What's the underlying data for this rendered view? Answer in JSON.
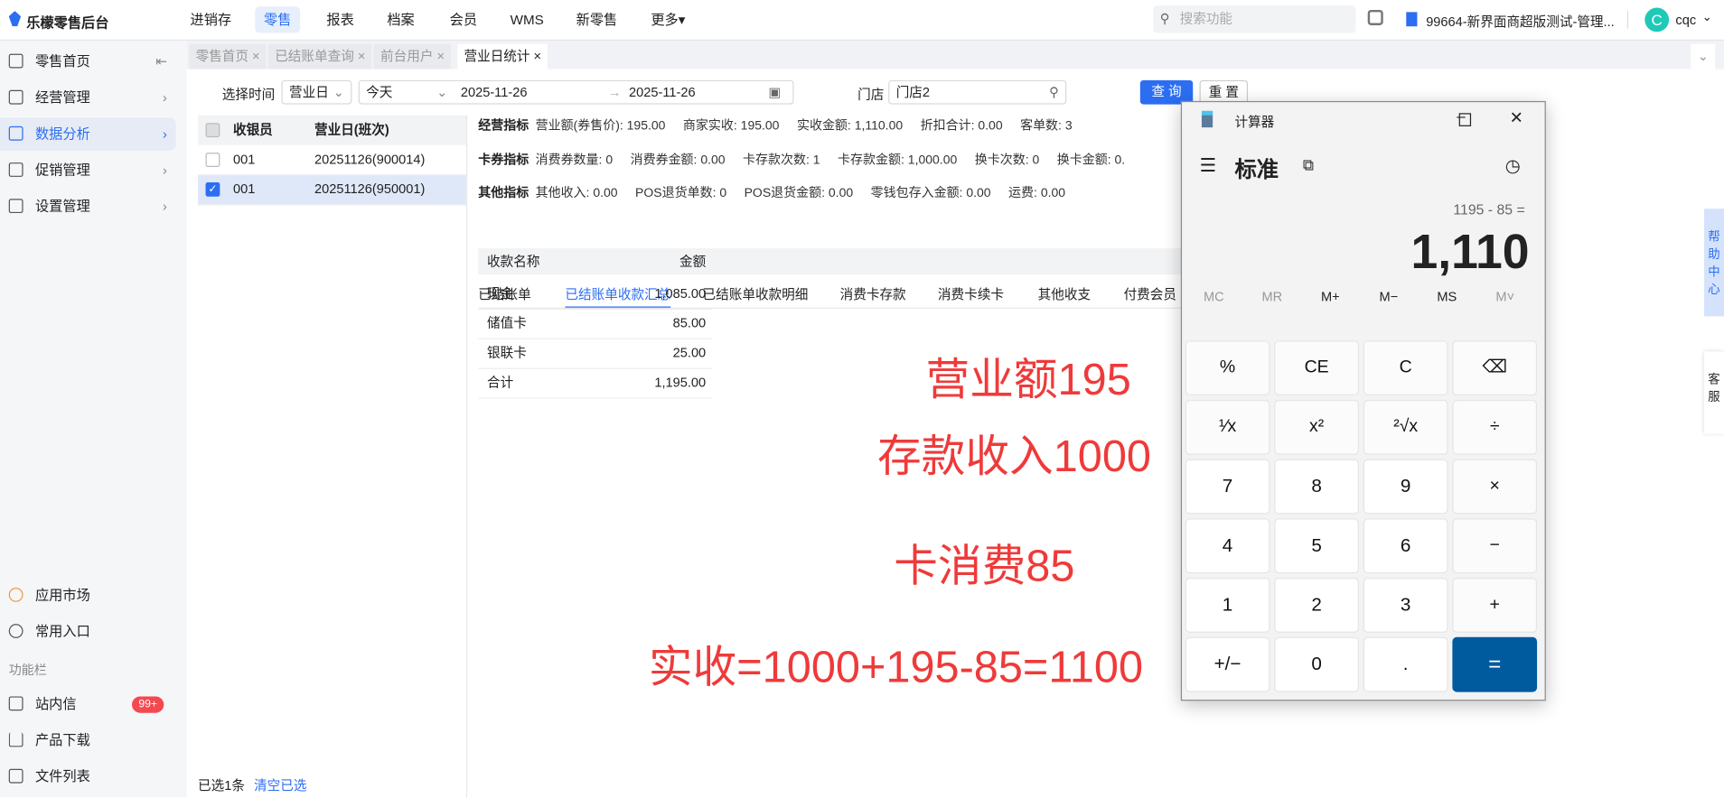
{
  "app": {
    "logo_text": "乐檬零售后台"
  },
  "topnav": [
    "进销存",
    "零售",
    "报表",
    "档案",
    "会员",
    "WMS",
    "新零售",
    "更多▾"
  ],
  "search_placeholder": "搜索功能",
  "store_account": "99664-新界面商超版测试-管理...",
  "user": {
    "avatar": "C",
    "name": "cqc"
  },
  "sidebar": {
    "items": [
      {
        "label": "零售首页"
      },
      {
        "label": "经营管理"
      },
      {
        "label": "数据分析"
      },
      {
        "label": "促销管理"
      },
      {
        "label": "设置管理"
      }
    ],
    "bottom": [
      {
        "label": "应用市场"
      },
      {
        "label": "常用入口"
      }
    ],
    "section": "功能栏",
    "bottom2": [
      {
        "label": "站内信",
        "badge": "99+"
      },
      {
        "label": "产品下载"
      },
      {
        "label": "文件列表"
      }
    ]
  },
  "tabs": [
    "零售首页 ×",
    "已结账单查询 ×",
    "前台用户 ×",
    "营业日统计 ×"
  ],
  "filters": {
    "time_label": "选择时间",
    "time_type": "营业日",
    "range": "今天",
    "date_from": "2025-11-26",
    "date_to": "2025-11-26",
    "store_label": "门店",
    "store_value": "门店2",
    "query": "查 询",
    "reset": "重 置"
  },
  "left_table": {
    "headers": [
      "收银员",
      "营业日(班次)"
    ],
    "rows": [
      [
        "001",
        "20251126(900014)"
      ],
      [
        "001",
        "20251126(950001)"
      ]
    ],
    "selected_text": "已选1条",
    "clear": "清空已选"
  },
  "metrics": [
    {
      "title": "经营指标",
      "items": [
        "营业额(券售价): 195.00",
        "商家实收: 195.00",
        "实收金额: 1,110.00",
        "折扣合计: 0.00",
        "客单数: 3"
      ]
    },
    {
      "title": "卡券指标",
      "items": [
        "消费券数量: 0",
        "消费券金额: 0.00",
        "卡存款次数: 1",
        "卡存款金额: 1,000.00",
        "换卡次数: 0",
        "换卡金额: 0."
      ]
    },
    {
      "title": "其他指标",
      "items": [
        "其他收入: 0.00",
        "POS退货单数: 0",
        "POS退货金额: 0.00",
        "零钱包存入金额: 0.00",
        "运费: 0.00"
      ]
    }
  ],
  "subtabs": [
    "已结账单",
    "已结账单收款汇总",
    "已结账单收款明细",
    "消费卡存款",
    "消费卡续卡",
    "其他收支",
    "付费会员"
  ],
  "pay_table": {
    "headers": [
      "收款名称",
      "金额"
    ],
    "rows": [
      [
        "现金",
        "1,085.00"
      ],
      [
        "储值卡",
        "85.00"
      ],
      [
        "银联卡",
        "25.00"
      ],
      [
        "合计",
        "1,195.00"
      ]
    ]
  },
  "annotations": [
    "营业额195",
    "存款收入1000",
    "卡消费85",
    "实收=1000+195-85=1100"
  ],
  "calculator": {
    "title": "计算器",
    "mode": "标准",
    "expression": "1195 - 85 =",
    "result": "1,110",
    "memory": [
      "MC",
      "MR",
      "M+",
      "M−",
      "MS",
      "M˅"
    ],
    "buttons": [
      "%",
      "CE",
      "C",
      "⌫",
      "¹⁄x",
      "x²",
      "²√x",
      "÷",
      "7",
      "8",
      "9",
      "×",
      "4",
      "5",
      "6",
      "−",
      "1",
      "2",
      "3",
      "+",
      "+/−",
      "0",
      ".",
      "="
    ]
  },
  "float": {
    "help": "帮助中心",
    "service": "客服"
  }
}
